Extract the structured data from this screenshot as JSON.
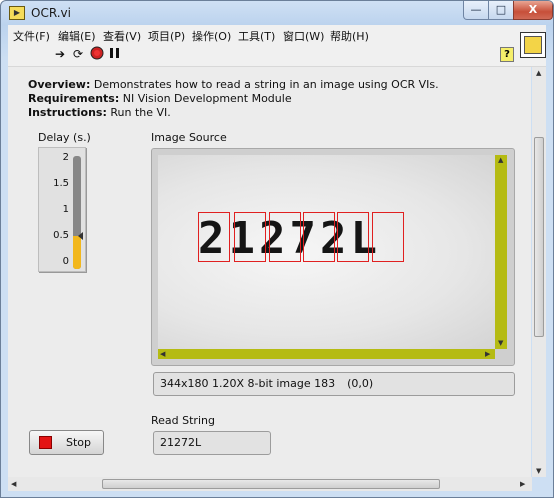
{
  "window": {
    "title": "OCR.vi",
    "controls": {
      "minimize": "—",
      "maximize": "□",
      "close": "X"
    }
  },
  "menu": [
    "文件(F)",
    "编辑(E)",
    "查看(V)",
    "项目(P)",
    "操作(O)",
    "工具(T)",
    "窗口(W)",
    "帮助(H)"
  ],
  "toolbar": {
    "run_icon": "run-arrow-icon",
    "run_continuous_icon": "run-continuous-icon",
    "abort_icon": "abort-icon",
    "pause_icon": "pause-icon",
    "help_label": "?"
  },
  "description": {
    "overview_label": "Overview:",
    "overview_text": " Demonstrates how to read a string in an image using OCR VIs.",
    "requirements_label": "Requirements:",
    "requirements_text": " NI Vision Development Module",
    "instructions_label": "Instructions:",
    "instructions_text": " Run the VI."
  },
  "delay": {
    "label": "Delay (s.)",
    "ticks": [
      "2",
      "1.5",
      "1",
      "0.5",
      "0"
    ],
    "value": 0.5,
    "max": 2,
    "fill_color": "#f2b71c"
  },
  "image_source": {
    "label": "Image Source",
    "characters": "21272L",
    "info": "344x180 1.20X 8-bit image 183",
    "coords": "(0,0)",
    "scroll_color": "#b5bb13",
    "roi_color": "#e02020"
  },
  "read_string": {
    "label": "Read String",
    "value": "21272L"
  },
  "stop": {
    "label": "Stop",
    "color": "#e31414"
  }
}
